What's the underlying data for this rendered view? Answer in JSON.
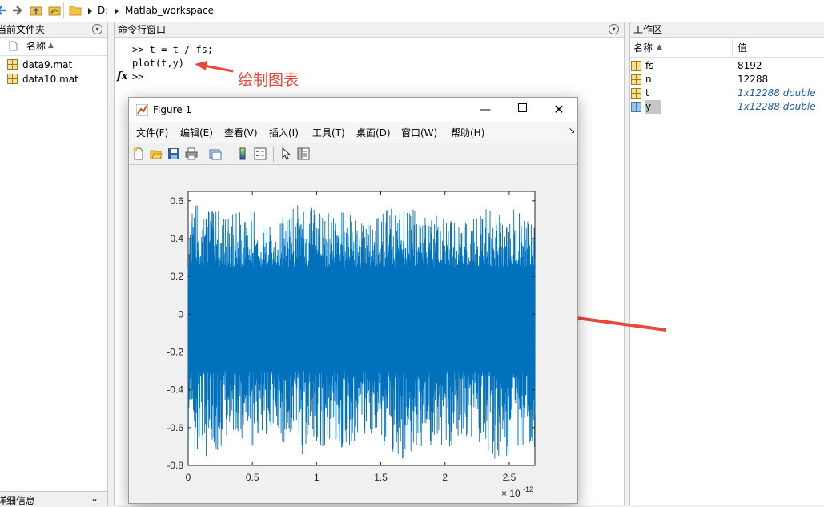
{
  "address_bar": {
    "crumbs": [
      "D:",
      "Matlab_workspace"
    ]
  },
  "current_folder": {
    "title": "当前文件夹",
    "column_name": "名称",
    "files": [
      "data9.mat",
      "data10.mat"
    ],
    "details_label": "详细信息"
  },
  "command_window": {
    "title": "命令行窗口",
    "lines": [
      ">> t = t / fs;",
      "plot(t,y)",
      ">>"
    ],
    "fx_label": "fx",
    "annotation": "绘制图表",
    "annotation_color": "#e8483a"
  },
  "workspace": {
    "title": "工作区",
    "col_name": "名称",
    "col_value": "值",
    "variables": [
      {
        "name": "fs",
        "value": "8192",
        "icon": "matrix-icon"
      },
      {
        "name": "n",
        "value": "12288",
        "icon": "matrix-icon"
      },
      {
        "name": "t",
        "value": "1x12288 double",
        "icon": "matrix-icon"
      },
      {
        "name": "y",
        "value": "1x12288 double",
        "icon": "matrix-icon-selected"
      }
    ]
  },
  "figure": {
    "title": "Figure 1",
    "menu": [
      "文件(F)",
      "编辑(E)",
      "查看(V)",
      "插入(I)",
      "工具(T)",
      "桌面(D)",
      "窗口(W)",
      "帮助(H)"
    ],
    "toolbar": [
      "new-figure-icon",
      "open-icon",
      "save-icon",
      "print-icon",
      "link-icon",
      "colorbar-icon",
      "legend-icon",
      "pointer-icon",
      "property-editor-icon"
    ]
  },
  "chart_data": {
    "type": "line",
    "series_color": "#0072bd",
    "xlim": [
      0,
      2.7
    ],
    "ylim": [
      -0.8,
      0.65
    ],
    "x_ticks": [
      "0",
      "0.5",
      "1",
      "1.5",
      "2",
      "2.5"
    ],
    "x_tick_values": [
      0,
      0.5,
      1,
      1.5,
      2,
      2.5
    ],
    "y_ticks": [
      "0.6",
      "0.4",
      "0.2",
      "0",
      "-0.2",
      "-0.4",
      "-0.6",
      "-0.8"
    ],
    "y_tick_values": [
      0.6,
      0.4,
      0.2,
      0,
      -0.2,
      -0.4,
      -0.6,
      -0.8
    ],
    "x_exponent_base": "× 10",
    "x_exponent": "-12",
    "grid": false,
    "description_envelope": {
      "upper_peak": 0.6,
      "upper_dense": 0.25,
      "lower_peak": -0.78,
      "lower_dense": -0.3
    }
  }
}
